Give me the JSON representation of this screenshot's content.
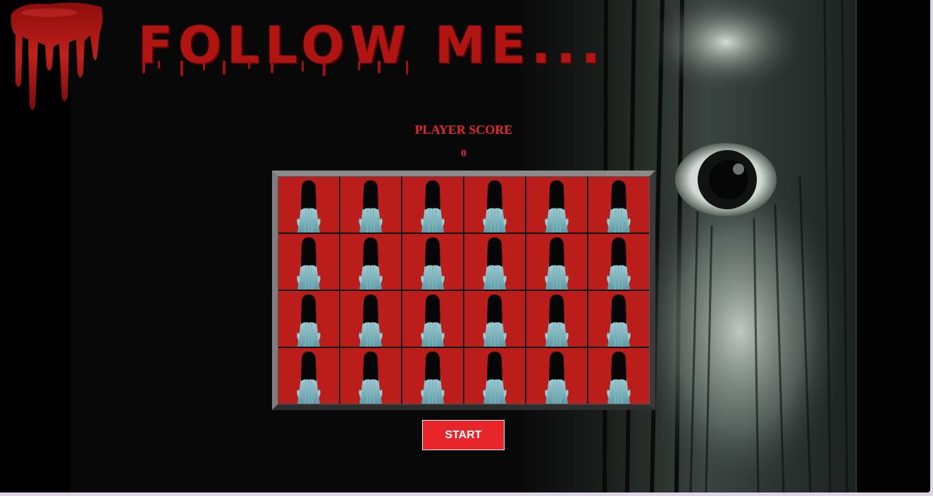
{
  "header": {
    "title": "FOLLOW ME..."
  },
  "score": {
    "label": "PLAYER SCORE",
    "value": "0"
  },
  "board": {
    "rows": 4,
    "columns": 6,
    "tile_icon": "ghost-girl-icon"
  },
  "controls": {
    "start_label": "START"
  },
  "colors": {
    "accent": "#e8262a",
    "tile": "#bb1d1a",
    "title": "#b11512",
    "background": "#000000"
  }
}
